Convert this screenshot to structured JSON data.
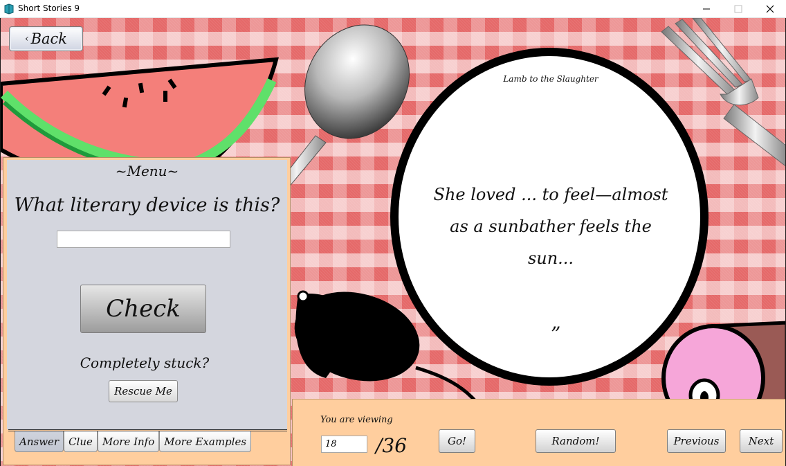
{
  "window": {
    "title": "Short Stories 9",
    "icon": "book-icon",
    "controls": [
      "minimize-icon",
      "maximize-icon",
      "close-icon"
    ]
  },
  "back_button": {
    "label": "Back",
    "arrow": "‹"
  },
  "menu": {
    "title": "~Menu~",
    "question": "What literary device is this?",
    "answer_value": "",
    "check_label": "Check",
    "stuck_label": "Completely stuck?",
    "rescue_label": "Rescue Me",
    "tabs": [
      {
        "label": "Answer",
        "active": true
      },
      {
        "label": "Clue",
        "active": false
      },
      {
        "label": "More Info",
        "active": false
      },
      {
        "label": "More Examples",
        "active": false
      }
    ]
  },
  "plate": {
    "source": "Lamb to the Slaughter",
    "quote_line1": "She loved ... to feel—almost",
    "quote_line2": "as a sunbather feels the sun...",
    "closing_mark": "”"
  },
  "navigation": {
    "viewing_label": "You are viewing",
    "current_page": "18",
    "total": "/36",
    "go_label": "Go!",
    "random_label": "Random!",
    "previous_label": "Previous",
    "next_label": "Next"
  },
  "colors": {
    "tablecloth_red": "#d71818",
    "panel_peach": "#ffce9e",
    "menu_gray": "#d4d6de",
    "watermelon_flesh": "#f47f7a",
    "watermelon_rind": "#5fe06a",
    "ham_pink": "#f6a6d9",
    "meat_brown": "#9a5a55"
  }
}
